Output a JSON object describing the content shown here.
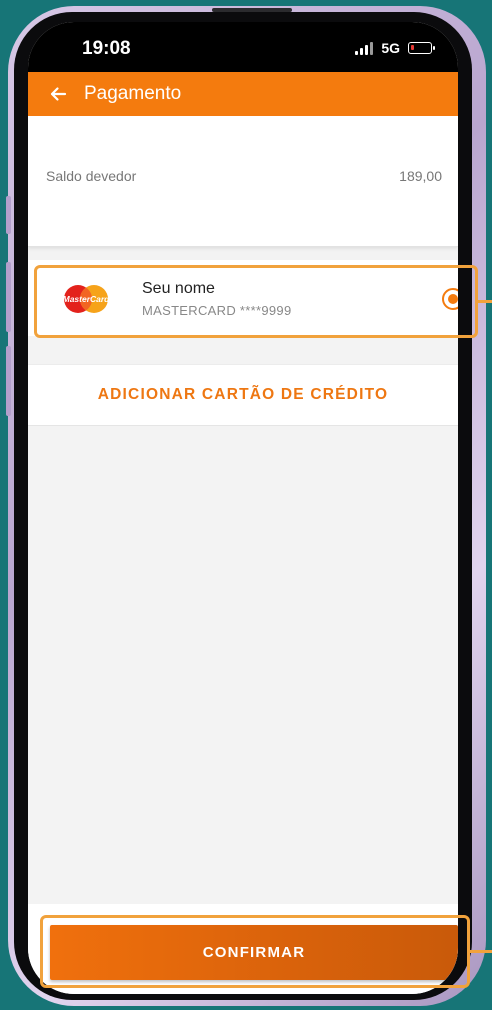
{
  "status_bar": {
    "time": "19:08",
    "network": "5G"
  },
  "app_bar": {
    "title": "Pagamento",
    "back_icon": "arrow-left-icon"
  },
  "balance": {
    "label": "Saldo devedor",
    "value": "189,00"
  },
  "selected_card": {
    "brand_logo": "mastercard-logo",
    "brand_logo_text": "MasterCard",
    "holder": "Seu nome",
    "number": "MASTERCARD ****9999",
    "selected": true
  },
  "add_card": {
    "label": "ADICIONAR CARTÃO DE CRÉDITO"
  },
  "confirm": {
    "label": "CONFIRMAR"
  },
  "colors": {
    "accent": "#f47b0e",
    "highlight": "#f1a23c",
    "background": "#177577"
  }
}
